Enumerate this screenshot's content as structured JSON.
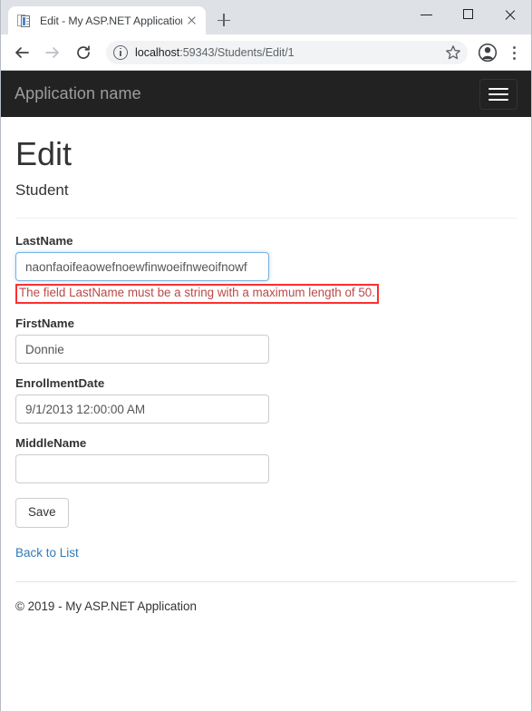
{
  "browser": {
    "tab": {
      "title": "Edit - My ASP.NET Application",
      "favicon": "document-icon",
      "close": "close-icon"
    },
    "new_tab": "plus-icon",
    "window_controls": {
      "minimize": "minimize-icon",
      "maximize": "maximize-icon",
      "close": "close-icon"
    },
    "toolbar": {
      "back": "back-arrow-icon",
      "forward": "forward-arrow-icon",
      "reload": "reload-icon",
      "site_info": "info-circle-icon",
      "url_host": "localhost",
      "url_path": ":59343/Students/Edit/1",
      "bookmark": "star-icon",
      "profile": "account-avatar-icon",
      "menu": "kebab-menu-icon"
    }
  },
  "page": {
    "navbar": {
      "brand": "Application name",
      "toggle": "hamburger-icon"
    },
    "title": "Edit",
    "subtitle": "Student",
    "form": {
      "fields": [
        {
          "label": "LastName",
          "value": "naonfaoifeaowefnoewfinwoeifnweoifnowf",
          "placeholder": "",
          "focused": true,
          "error": "The field LastName must be a string with a maximum length of 50."
        },
        {
          "label": "FirstName",
          "value": "Donnie",
          "placeholder": "",
          "focused": false,
          "error": ""
        },
        {
          "label": "EnrollmentDate",
          "value": "9/1/2013 12:00:00 AM",
          "placeholder": "",
          "focused": false,
          "error": ""
        },
        {
          "label": "MiddleName",
          "value": "",
          "placeholder": "",
          "focused": false,
          "error": ""
        }
      ],
      "save_label": "Save"
    },
    "back_link": "Back to List",
    "footer": "© 2019 - My ASP.NET Application"
  },
  "colors": {
    "navbar_bg": "#222222",
    "brand_text": "#9d9d9d",
    "error_text": "#b94a48",
    "error_highlight_border": "#ff2f2f",
    "link": "#337ab7",
    "input_border": "#cccccc",
    "input_focus_border": "#79b1e0"
  }
}
